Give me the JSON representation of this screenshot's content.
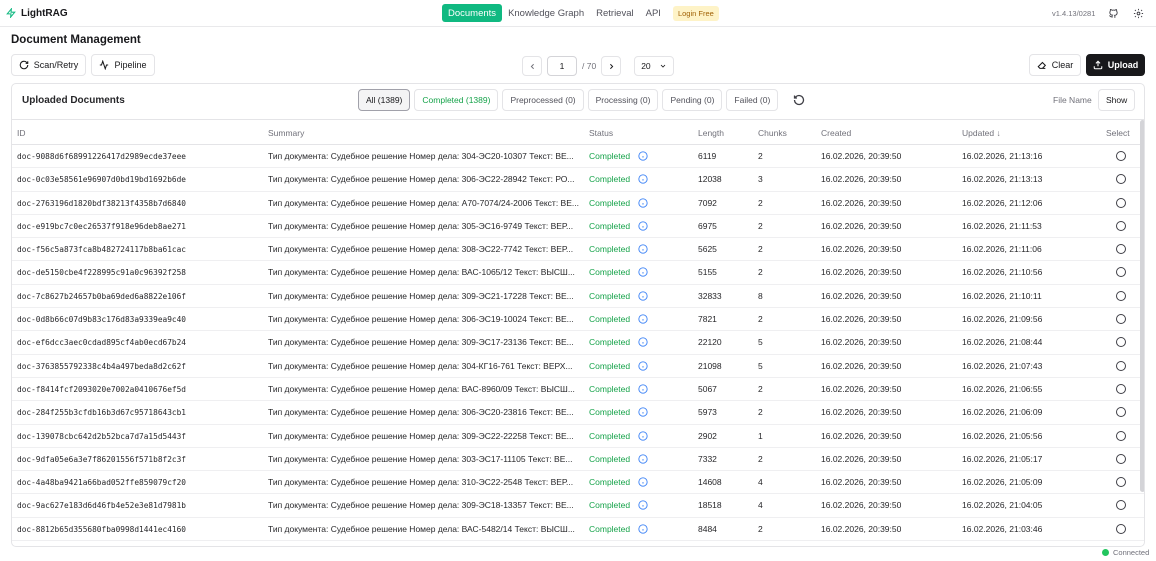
{
  "app": {
    "name": "LightRAG",
    "version": "v1.4.13/0281"
  },
  "nav": {
    "tabs": [
      "Documents",
      "Knowledge Graph",
      "Retrieval",
      "API"
    ],
    "active": "Documents",
    "login_badge": "Login Free"
  },
  "page": {
    "title": "Document Management"
  },
  "toolbar": {
    "scan_label": "Scan/Retry",
    "pipeline_label": "Pipeline",
    "clear_label": "Clear",
    "upload_label": "Upload"
  },
  "pagination": {
    "current": "1",
    "total": "/ 70",
    "page_size": "20"
  },
  "panel": {
    "title": "Uploaded Documents",
    "filters": [
      "All (1389)",
      "Completed (1389)",
      "Preprocessed (0)",
      "Processing (0)",
      "Pending (0)",
      "Failed (0)"
    ],
    "file_name_label": "File Name",
    "show_label": "Show"
  },
  "table": {
    "columns": [
      "ID",
      "Summary",
      "Status",
      "Length",
      "Chunks",
      "Created",
      "Updated ↓",
      "Select"
    ],
    "rows": [
      {
        "id": "doc-9088d6f68991226417d2989ecde37eee",
        "summary": "Тип документа: Судебное решение Номер дела: 304-ЭС20-10307 Текст: ВЕ...",
        "status": "Completed",
        "length": "6119",
        "chunks": "2",
        "created": "16.02.2026, 20:39:50",
        "updated": "16.02.2026, 21:13:16"
      },
      {
        "id": "doc-0c03e58561e96907d0bd19bd1692b6de",
        "summary": "Тип документа: Судебное решение Номер дела: 306-ЭС22-28942 Текст: РО...",
        "status": "Completed",
        "length": "12038",
        "chunks": "3",
        "created": "16.02.2026, 20:39:50",
        "updated": "16.02.2026, 21:13:13"
      },
      {
        "id": "doc-2763196d1820bdf38213f4358b7d6840",
        "summary": "Тип документа: Судебное решение Номер дела: А70-7074/24-2006 Текст: ВЕ...",
        "status": "Completed",
        "length": "7092",
        "chunks": "2",
        "created": "16.02.2026, 20:39:50",
        "updated": "16.02.2026, 21:12:06"
      },
      {
        "id": "doc-e919bc7c0ec26537f918e96deb8ae271",
        "summary": "Тип документа: Судебное решение Номер дела: 305-ЭС16-9749 Текст: ВЕР...",
        "status": "Completed",
        "length": "6975",
        "chunks": "2",
        "created": "16.02.2026, 20:39:50",
        "updated": "16.02.2026, 21:11:53"
      },
      {
        "id": "doc-f56c5a873fca8b482724117b8ba61cac",
        "summary": "Тип документа: Судебное решение Номер дела: 308-ЭС22-7742 Текст: ВЕР...",
        "status": "Completed",
        "length": "5625",
        "chunks": "2",
        "created": "16.02.2026, 20:39:50",
        "updated": "16.02.2026, 21:11:06"
      },
      {
        "id": "doc-de5150cbe4f228995c91a0c96392f258",
        "summary": "Тип документа: Судебное решение Номер дела: ВАС-1065/12 Текст: ВЫСШ...",
        "status": "Completed",
        "length": "5155",
        "chunks": "2",
        "created": "16.02.2026, 20:39:50",
        "updated": "16.02.2026, 21:10:56"
      },
      {
        "id": "doc-7c8627b24657b0ba69ded6a8822e106f",
        "summary": "Тип документа: Судебное решение Номер дела: 309-ЭС21-17228 Текст: ВЕ...",
        "status": "Completed",
        "length": "32833",
        "chunks": "8",
        "created": "16.02.2026, 20:39:50",
        "updated": "16.02.2026, 21:10:11"
      },
      {
        "id": "doc-0d8b66c07d9b83c176d83a9339ea9c40",
        "summary": "Тип документа: Судебное решение Номер дела: 306-ЭС19-10024 Текст: ВЕ...",
        "status": "Completed",
        "length": "7821",
        "chunks": "2",
        "created": "16.02.2026, 20:39:50",
        "updated": "16.02.2026, 21:09:56"
      },
      {
        "id": "doc-ef6dcc3aec0cdad895cf4ab0ecd67b24",
        "summary": "Тип документа: Судебное решение Номер дела: 309-ЭС17-23136 Текст: ВЕ...",
        "status": "Completed",
        "length": "22120",
        "chunks": "5",
        "created": "16.02.2026, 20:39:50",
        "updated": "16.02.2026, 21:08:44"
      },
      {
        "id": "doc-3763855792338c4b4a497beda8d2c62f",
        "summary": "Тип документа: Судебное решение Номер дела: 304-КГ16-761 Текст: ВЕРХ...",
        "status": "Completed",
        "length": "21098",
        "chunks": "5",
        "created": "16.02.2026, 20:39:50",
        "updated": "16.02.2026, 21:07:43"
      },
      {
        "id": "doc-f8414fcf2093020e7002a0410676ef5d",
        "summary": "Тип документа: Судебное решение Номер дела: ВАС-8960/09 Текст: ВЫСШ...",
        "status": "Completed",
        "length": "5067",
        "chunks": "2",
        "created": "16.02.2026, 20:39:50",
        "updated": "16.02.2026, 21:06:55"
      },
      {
        "id": "doc-284f255b3cfdb16b3d67c95718643cb1",
        "summary": "Тип документа: Судебное решение Номер дела: 306-ЭС20-23816 Текст: ВЕ...",
        "status": "Completed",
        "length": "5973",
        "chunks": "2",
        "created": "16.02.2026, 20:39:50",
        "updated": "16.02.2026, 21:06:09"
      },
      {
        "id": "doc-139078cbc642d2b52bca7d7a15d5443f",
        "summary": "Тип документа: Судебное решение Номер дела: 309-ЭС22-22258 Текст: ВЕ...",
        "status": "Completed",
        "length": "2902",
        "chunks": "1",
        "created": "16.02.2026, 20:39:50",
        "updated": "16.02.2026, 21:05:56"
      },
      {
        "id": "doc-9dfa05e6a3e7f86201556f571b8f2c3f",
        "summary": "Тип документа: Судебное решение Номер дела: 303-ЭС17-11105 Текст: ВЕ...",
        "status": "Completed",
        "length": "7332",
        "chunks": "2",
        "created": "16.02.2026, 20:39:50",
        "updated": "16.02.2026, 21:05:17"
      },
      {
        "id": "doc-4a48ba9421a66bad052ffe859079cf20",
        "summary": "Тип документа: Судебное решение Номер дела: 310-ЭС22-2548 Текст: ВЕР...",
        "status": "Completed",
        "length": "14608",
        "chunks": "4",
        "created": "16.02.2026, 20:39:50",
        "updated": "16.02.2026, 21:05:09"
      },
      {
        "id": "doc-9ac627e183d6d46fb4e52e3e81d7981b",
        "summary": "Тип документа: Судебное решение Номер дела: 309-ЭС18-13357 Текст: ВЕ...",
        "status": "Completed",
        "length": "18518",
        "chunks": "4",
        "created": "16.02.2026, 20:39:50",
        "updated": "16.02.2026, 21:04:05"
      },
      {
        "id": "doc-8812b65d355680fba0998d1441ec4160",
        "summary": "Тип документа: Судебное решение Номер дела: ВАС-5482/14 Текст: ВЫСШ...",
        "status": "Completed",
        "length": "8484",
        "chunks": "2",
        "created": "16.02.2026, 20:39:50",
        "updated": "16.02.2026, 21:03:46"
      }
    ]
  },
  "footer": {
    "connection": "Connected"
  },
  "colors": {
    "accent": "#10b981",
    "status_completed": "#16a34a",
    "info": "#3b82f6",
    "connected": "#22c55e"
  },
  "icons": [
    "zap-icon",
    "github-icon",
    "settings-icon",
    "refresh-icon",
    "activity-icon",
    "chevron-left-icon",
    "chevron-right-icon",
    "chevron-down-icon",
    "eraser-icon",
    "upload-icon",
    "info-icon"
  ]
}
